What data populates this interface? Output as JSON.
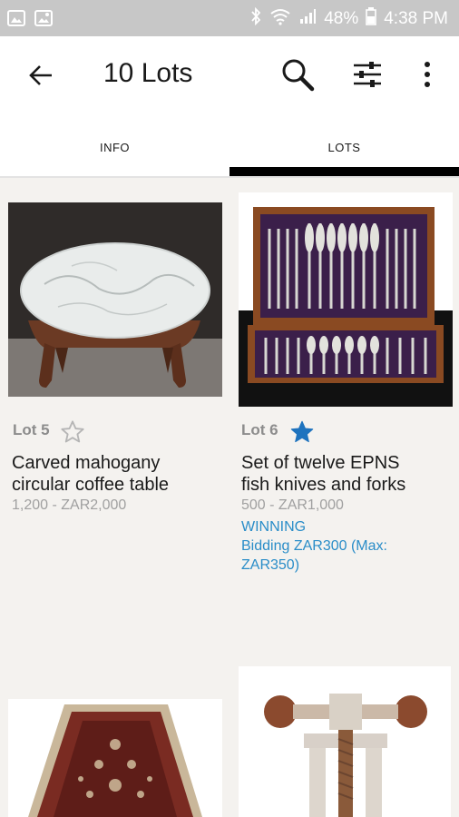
{
  "status_bar": {
    "battery": "48%",
    "time": "4:38 PM"
  },
  "app_bar": {
    "title": "10 Lots"
  },
  "tabs": [
    {
      "label": "INFO",
      "selected": false
    },
    {
      "label": "LOTS",
      "selected": true
    }
  ],
  "lots": [
    {
      "lot_number": "Lot 5",
      "title_line1": "Carved mahogany",
      "title_line2": "circular coffee table",
      "estimate": "1,200 - ZAR2,000",
      "favorited": false
    },
    {
      "lot_number": "Lot 6",
      "title_line1": "Set of twelve EPNS",
      "title_line2": "fish knives and forks",
      "estimate": "500 - ZAR1,000",
      "status": "WINNING",
      "bid_line1": "Bidding ZAR300 (Max:",
      "bid_line2": "ZAR350)",
      "favorited": true
    }
  ],
  "colors": {
    "accent": "#2a8dc8",
    "star_filled": "#1e73be",
    "status_bar": "#c7c7c7"
  }
}
